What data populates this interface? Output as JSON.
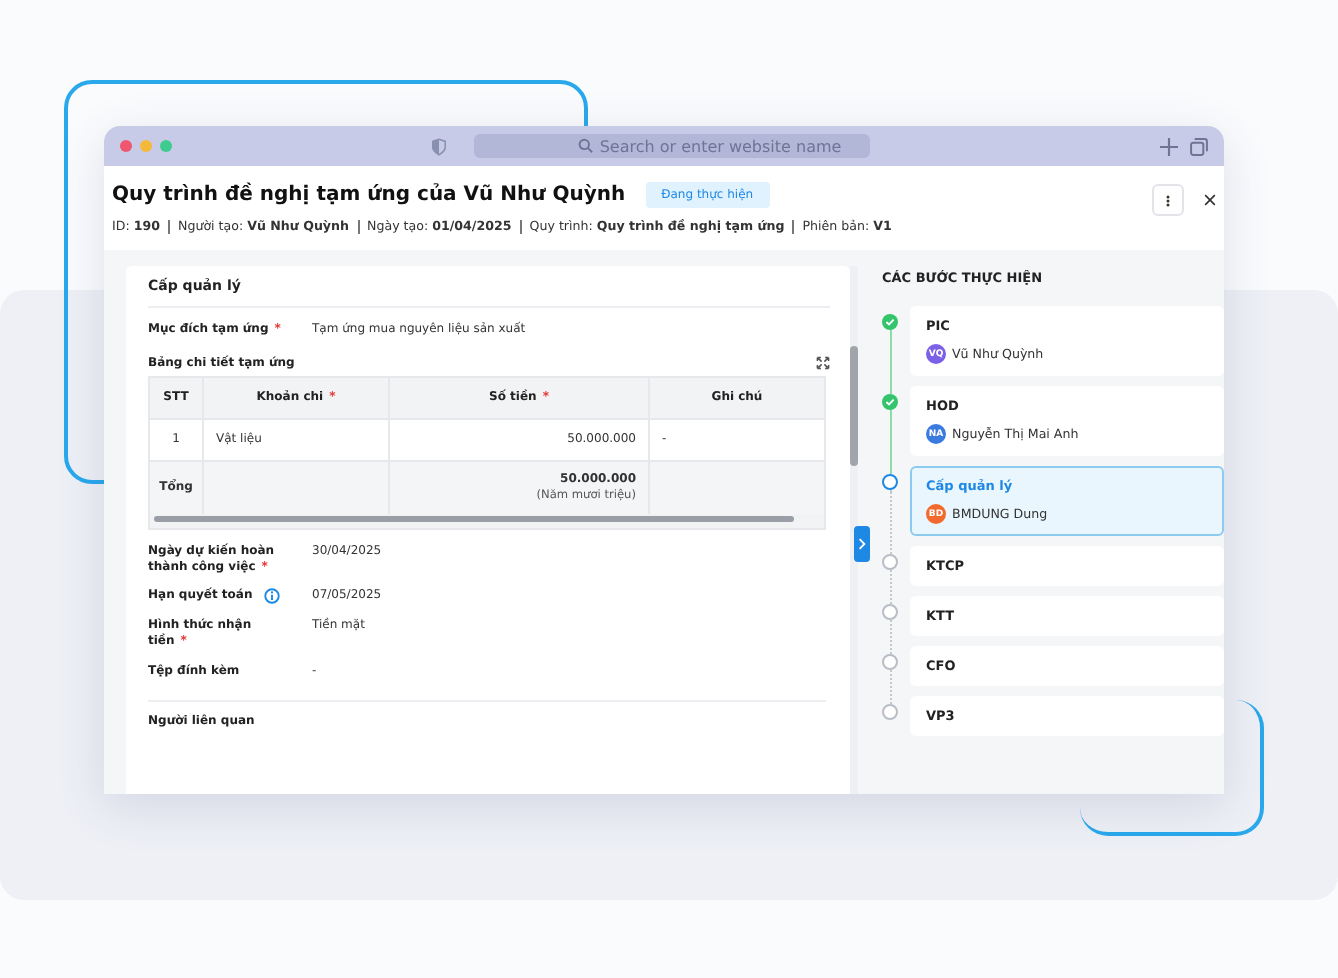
{
  "browser": {
    "address_placeholder": "Search or enter website name"
  },
  "header": {
    "title": "Quy trình đề nghị tạm ứng của Vũ Như Quỳnh",
    "status": "Đang thực hiện",
    "meta": [
      {
        "label": "ID:",
        "value": "190"
      },
      {
        "label": "Người tạo:",
        "value": "Vũ Như Quỳnh"
      },
      {
        "label": "Ngày tạo:",
        "value": "01/04/2025"
      },
      {
        "label": "Quy trình:",
        "value": "Quy trình đề nghị tạm ứng"
      },
      {
        "label": "Phiên bản:",
        "value": "V1"
      }
    ]
  },
  "required_mark": "*",
  "form": {
    "section_title": "Cấp quản lý",
    "purpose": {
      "label": "Mục đích tạm ứng",
      "required": true,
      "value": "Tạm ứng mua nguyên liệu sản xuất"
    },
    "table_title": "Bảng chi tiết tạm ứng",
    "table": {
      "columns": [
        {
          "label": "STT",
          "required": false
        },
        {
          "label": "Khoản chi",
          "required": true
        },
        {
          "label": "Số tiền",
          "required": true
        },
        {
          "label": "Ghi chú",
          "required": false
        }
      ],
      "rows": [
        [
          "1",
          "Vật liệu",
          "50.000.000",
          "-"
        ]
      ],
      "total": {
        "label": "Tổng",
        "amount": "50.000.000",
        "in_words": "(Năm mươi triệu)"
      }
    },
    "fields": [
      {
        "label": "Ngày dự kiến hoàn thành công việc",
        "required": true,
        "info": false,
        "value": "30/04/2025"
      },
      {
        "label": "Hạn quyết toán",
        "required": false,
        "info": true,
        "value": "07/05/2025"
      },
      {
        "label": "Hình thức nhận tiền",
        "required": true,
        "info": false,
        "value": "Tiền mặt"
      },
      {
        "label": "Tệp đính kèm",
        "required": false,
        "info": false,
        "value": "-"
      }
    ],
    "next_section": "Người liên quan"
  },
  "steps": {
    "title": "CÁC BƯỚC THỰC HIỆN",
    "items": [
      {
        "name": "PIC",
        "kind": "done",
        "assignee": {
          "initials": "VQ",
          "name": "Vũ Như Quỳnh",
          "color": "#7b61e8"
        }
      },
      {
        "name": "HOD",
        "kind": "done",
        "assignee": {
          "initials": "NA",
          "name": "Nguyễn Thị Mai Anh",
          "color": "#3b7be0"
        }
      },
      {
        "name": "Cấp quản lý",
        "kind": "current",
        "assignee": {
          "initials": "BD",
          "name": "BMDUNG Dung",
          "color": "#f26a2e"
        }
      },
      {
        "name": "KTCP",
        "kind": "pending"
      },
      {
        "name": "KTT",
        "kind": "pending"
      },
      {
        "name": "CFO",
        "kind": "pending"
      },
      {
        "name": "VP3",
        "kind": "pending"
      }
    ]
  }
}
